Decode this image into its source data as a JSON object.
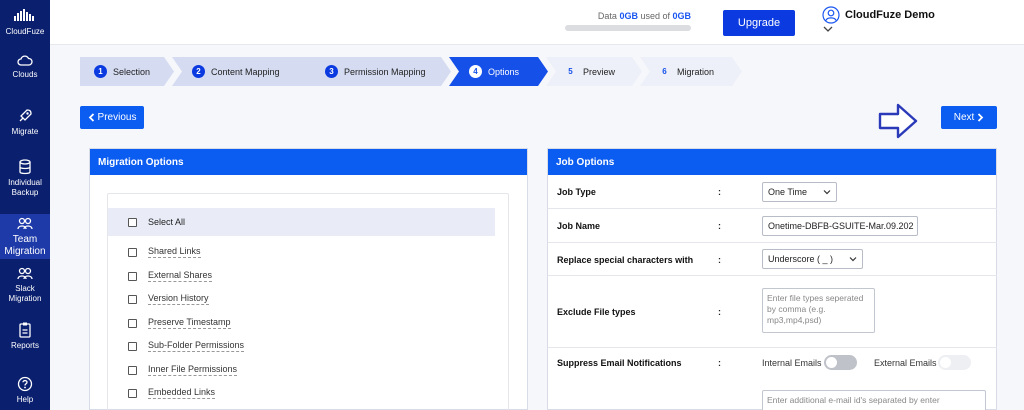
{
  "sidebar": {
    "brand": "CloudFuze",
    "items": [
      {
        "label": "Clouds",
        "icon": "cloud-icon"
      },
      {
        "label": "Migrate",
        "icon": "rocket-icon"
      },
      {
        "label": "Individual Backup",
        "icon": "database-icon"
      },
      {
        "label": "Team Migration",
        "icon": "team-icon"
      },
      {
        "label": "Slack Migration",
        "icon": "team-icon"
      },
      {
        "label": "Reports",
        "icon": "report-icon"
      },
      {
        "label": "Help",
        "icon": "help-icon"
      }
    ]
  },
  "topbar": {
    "data_prefix": "Data ",
    "data_used": "0GB",
    "data_mid": " used of ",
    "data_total": "0GB",
    "upgrade_label": "Upgrade",
    "user_name": "CloudFuze Demo"
  },
  "steps": [
    {
      "num": "1",
      "label": "Selection"
    },
    {
      "num": "2",
      "label": "Content Mapping"
    },
    {
      "num": "3",
      "label": "Permission Mapping"
    },
    {
      "num": "4",
      "label": "Options"
    },
    {
      "num": "5",
      "label": "Preview"
    },
    {
      "num": "6",
      "label": "Migration"
    }
  ],
  "nav": {
    "previous_label": "Previous",
    "next_label": "Next"
  },
  "migration_options": {
    "title": "Migration Options",
    "select_all": "Select All",
    "options": [
      "Shared Links",
      "External Shares",
      "Version History",
      "Preserve Timestamp",
      "Sub-Folder Permissions",
      "Inner File Permissions",
      "Embedded Links"
    ]
  },
  "job_options": {
    "title": "Job Options",
    "colon": ":",
    "job_type_label": "Job Type",
    "job_type_value": "One Time",
    "job_name_label": "Job Name",
    "job_name_value": "Onetime-DBFB-GSUITE-Mar.09.202",
    "replace_label": "Replace special characters with",
    "replace_value": "Underscore ( _ )",
    "exclude_label": "Exclude File types",
    "exclude_placeholder": "Enter file types seperated by comma (e.g. mp3,mp4,psd)",
    "suppress_label": "Suppress Email Notifications",
    "internal_emails": "Internal Emails",
    "external_emails": "External Emails",
    "additional_placeholder": "Enter additional e-mail id's separated by enter"
  },
  "colors": {
    "sidebar": "#0a1f6e",
    "primary": "#0b5cf0",
    "upgrade": "#0b3ae0"
  }
}
